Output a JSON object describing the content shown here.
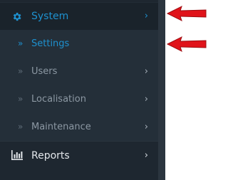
{
  "sidebar": {
    "system": {
      "label": "System",
      "icon": "gear-icon",
      "chevron": "›"
    },
    "items": [
      {
        "label": "Settings",
        "bullet": "»",
        "chevron": ""
      },
      {
        "label": "Users",
        "bullet": "»",
        "chevron": "›"
      },
      {
        "label": "Localisation",
        "bullet": "»",
        "chevron": "›"
      },
      {
        "label": "Maintenance",
        "bullet": "»",
        "chevron": "›"
      }
    ],
    "reports": {
      "label": "Reports",
      "icon": "bar-chart-icon",
      "chevron": "›"
    }
  },
  "colors": {
    "sidebar_bg": "#1e2730",
    "submenu_bg": "#242f39",
    "active_blue": "#1e91cf",
    "annotation_red": "#e0131a"
  }
}
